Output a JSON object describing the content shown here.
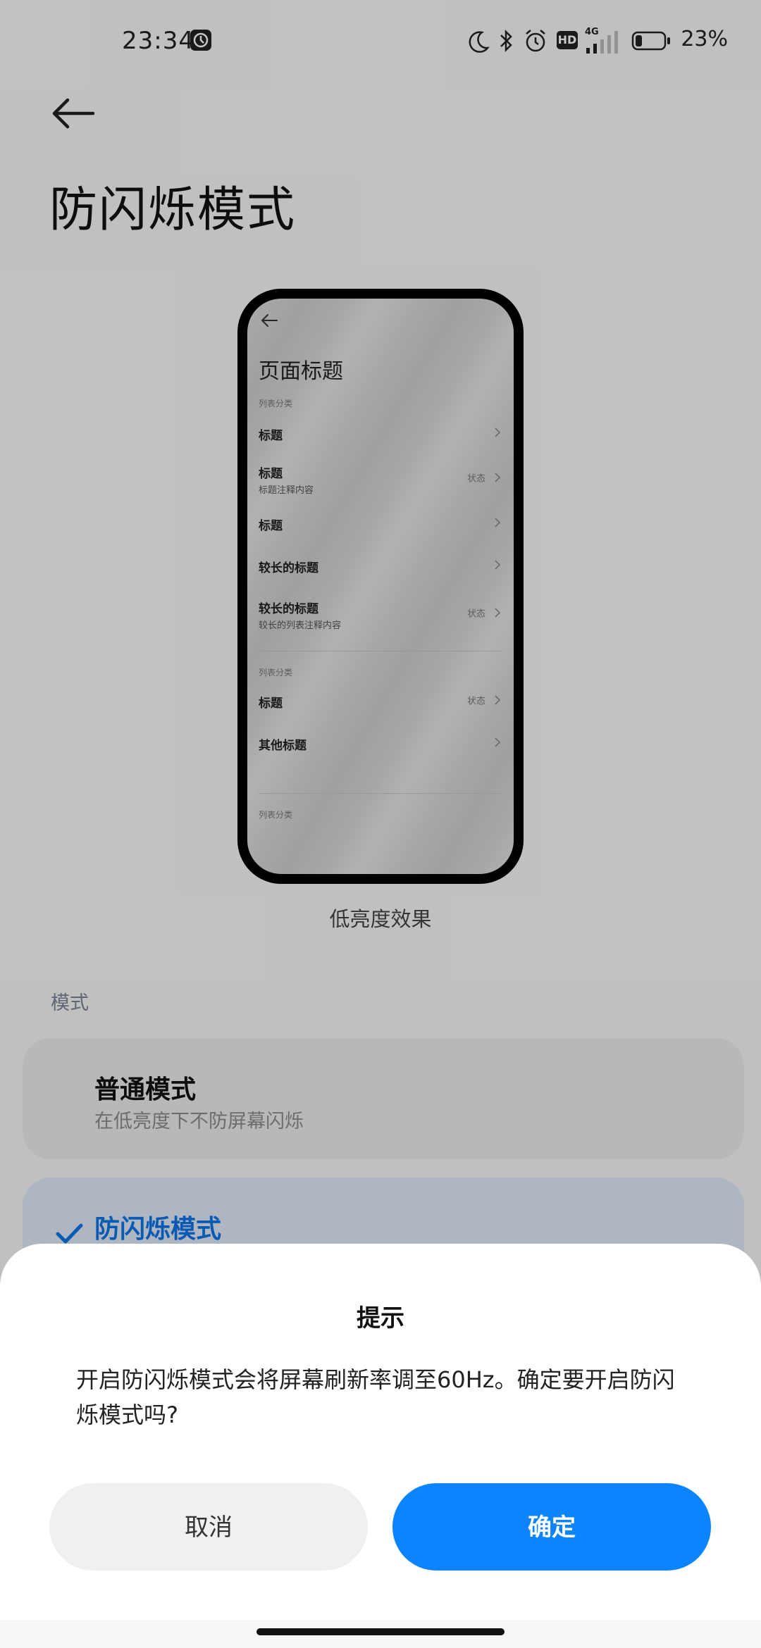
{
  "status_bar": {
    "time": "23:34",
    "network": "4G",
    "hd_label": "HD",
    "battery_percent": "23%",
    "battery_level": 0.23,
    "icons": [
      "moon-icon",
      "bluetooth-icon",
      "alarm-icon",
      "hd-icon",
      "signal-icon",
      "battery-icon"
    ]
  },
  "header": {
    "title": "防闪烁模式"
  },
  "preview": {
    "page_title": "页面标题",
    "sections": [
      {
        "label": "列表分类",
        "items": [
          {
            "title": "标题",
            "subtitle": "",
            "status": ""
          },
          {
            "title": "标题",
            "subtitle": "标题注释内容",
            "status": "状态"
          },
          {
            "title": "标题",
            "subtitle": "",
            "status": ""
          },
          {
            "title": "较长的标题",
            "subtitle": "",
            "status": ""
          },
          {
            "title": "较长的标题",
            "subtitle": "较长的列表注释内容",
            "status": "状态"
          }
        ]
      },
      {
        "label": "列表分类",
        "items": [
          {
            "title": "标题",
            "subtitle": "",
            "status": "状态"
          },
          {
            "title": "其他标题",
            "subtitle": "",
            "status": ""
          }
        ]
      },
      {
        "label": "列表分类",
        "items": []
      }
    ],
    "caption": "低亮度效果"
  },
  "modes": {
    "section_label": "模式",
    "normal": {
      "title": "普通模式",
      "subtitle": "在低亮度下不防屏幕闪烁"
    },
    "anti_flicker": {
      "title": "防闪烁模式",
      "selected": true
    }
  },
  "dialog": {
    "title": "提示",
    "message": "开启防闪烁模式会将屏幕刷新率调至60Hz。确定要开启防闪烁模式吗?",
    "cancel_label": "取消",
    "confirm_label": "确定"
  },
  "colors": {
    "accent": "#0d84ff",
    "selected_text": "#0d74e6",
    "selected_card": "#dfeaf9"
  }
}
